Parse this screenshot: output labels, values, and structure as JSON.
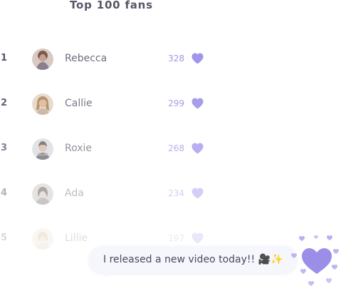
{
  "header": {
    "title": "Top 100 fans"
  },
  "fans": [
    {
      "rank": "1",
      "name": "Rebecca",
      "count": "328",
      "avatar": "avatar-rebecca"
    },
    {
      "rank": "2",
      "name": "Callie",
      "count": "299",
      "avatar": "avatar-callie"
    },
    {
      "rank": "3",
      "name": "Roxie",
      "count": "268",
      "avatar": "avatar-roxie"
    },
    {
      "rank": "4",
      "name": "Ada",
      "count": "234",
      "avatar": "avatar-ada"
    },
    {
      "rank": "5",
      "name": "Lillie",
      "count": "197",
      "avatar": "avatar-lillie"
    }
  ],
  "message": {
    "text": "I released a new video today!! 🎥✨"
  },
  "colors": {
    "accent": "#9f95ea",
    "heart_big": "#9a8ee8"
  }
}
